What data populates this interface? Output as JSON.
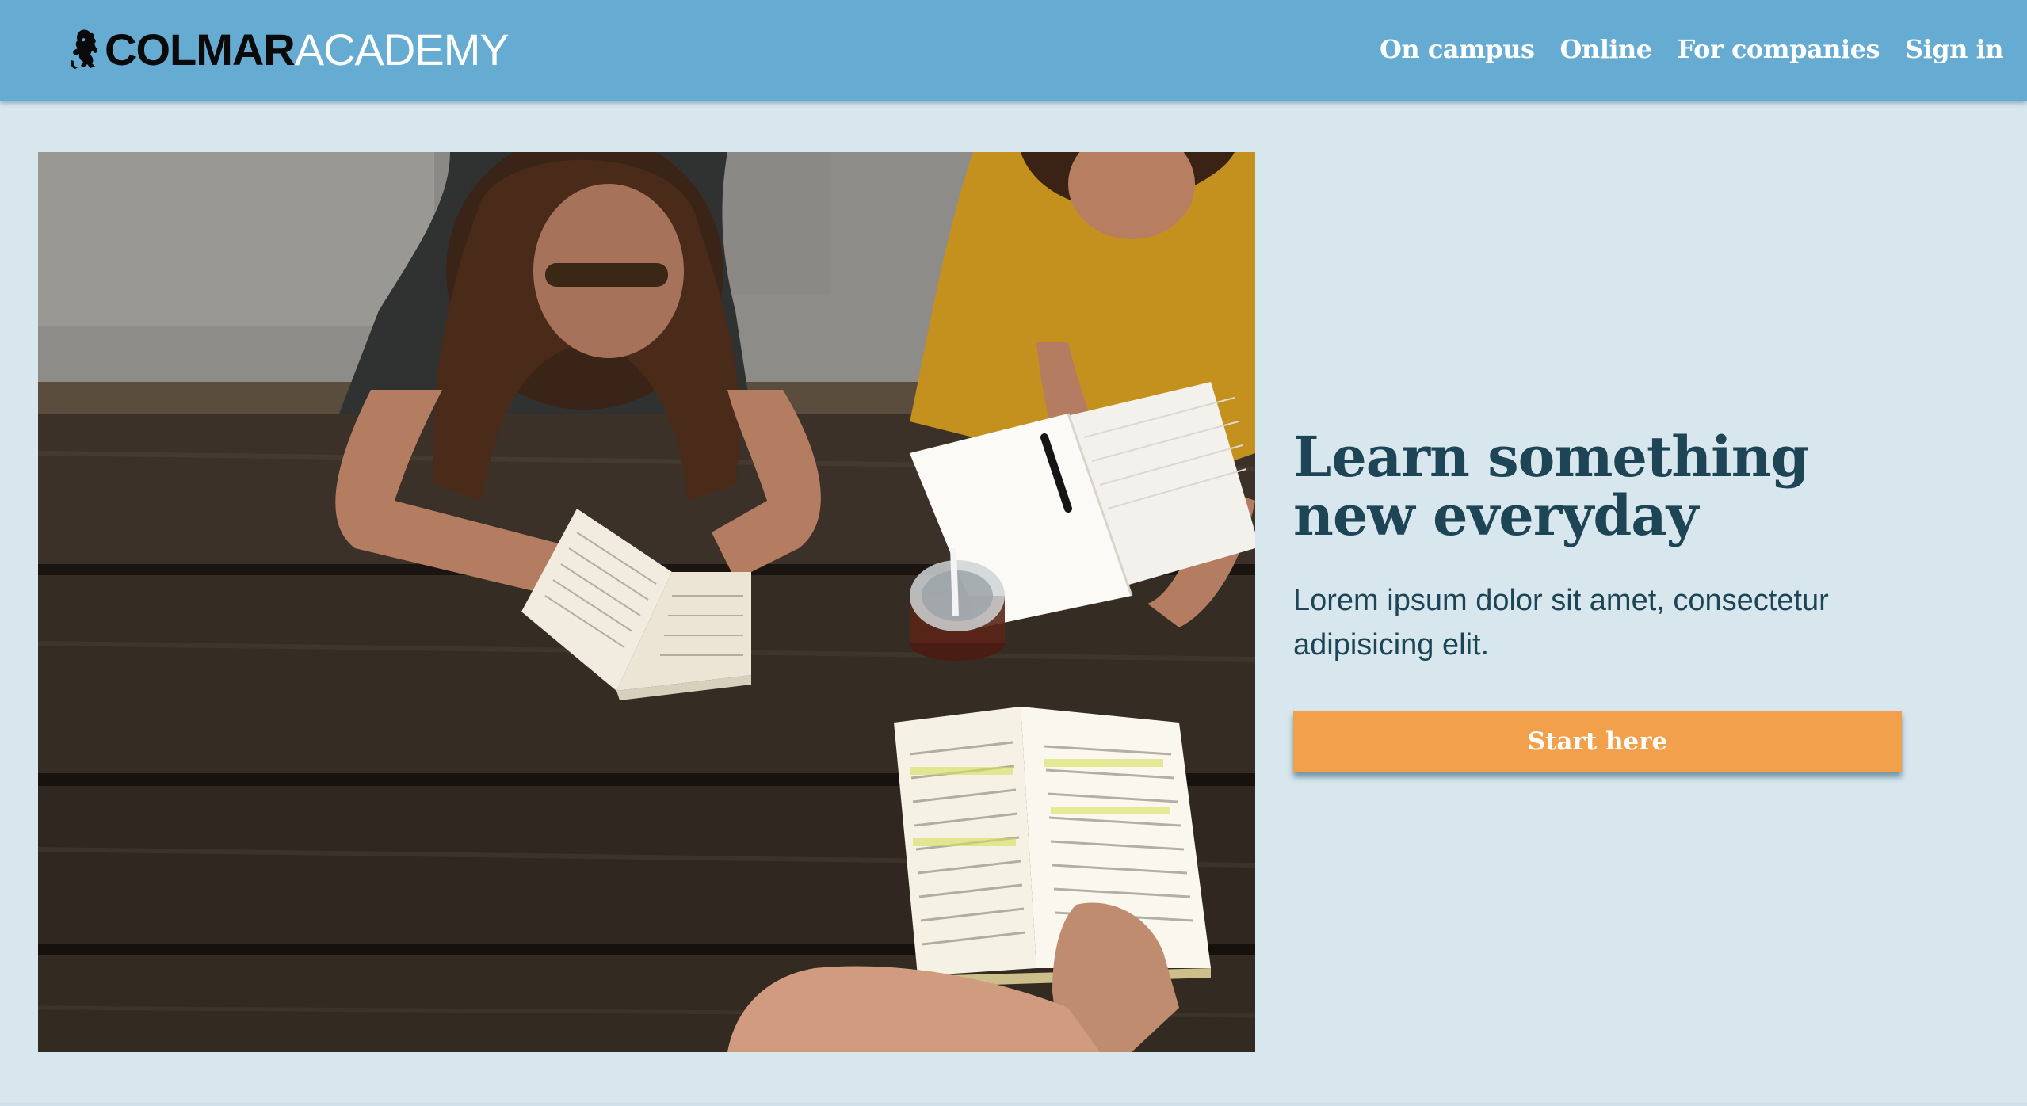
{
  "header": {
    "logo": {
      "strong": "COLMAR",
      "light": "ACADEMY",
      "icon": "lion-rampant-icon"
    },
    "nav": [
      {
        "label": "On campus"
      },
      {
        "label": "Online"
      },
      {
        "label": "For companies"
      },
      {
        "label": "Sign in"
      }
    ]
  },
  "hero": {
    "image": "students-studying-at-picnic-table-photo",
    "heading": "Learn something new everyday",
    "subtext": "Lorem ipsum dolor sit amet, consectetur adipisicing elit.",
    "cta_label": "Start here"
  },
  "colors": {
    "header_bg": "#66acd2",
    "page_bg": "#d8e7ee",
    "heading_text": "#1d4556",
    "cta_bg": "#f3a04c",
    "cta_text": "#ffffff"
  }
}
